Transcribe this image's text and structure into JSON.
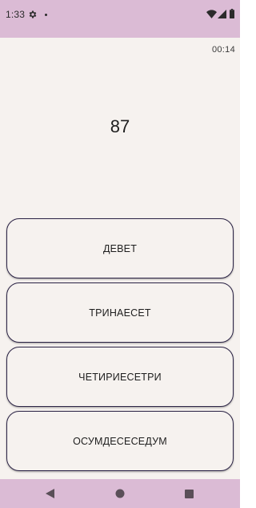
{
  "status_bar": {
    "time": "1:33",
    "icons": [
      "gear-icon",
      "notification-dot-icon",
      "wifi-icon",
      "cell-signal-icon",
      "battery-icon"
    ]
  },
  "timer": "00:14",
  "number": "87",
  "answers": [
    {
      "label": "ДЕВЕТ"
    },
    {
      "label": "ТРИНАЕСЕТ"
    },
    {
      "label": "ЧЕТИРИЕСЕТРИ"
    },
    {
      "label": "ОСУМДЕСЕСЕДУМ"
    }
  ],
  "nav_bar": {
    "icons": [
      "back-icon",
      "home-icon",
      "recents-icon"
    ]
  },
  "colors": {
    "bars": "#dbbbd5",
    "background": "#f6f2ef",
    "button_border": "#2d2547"
  }
}
